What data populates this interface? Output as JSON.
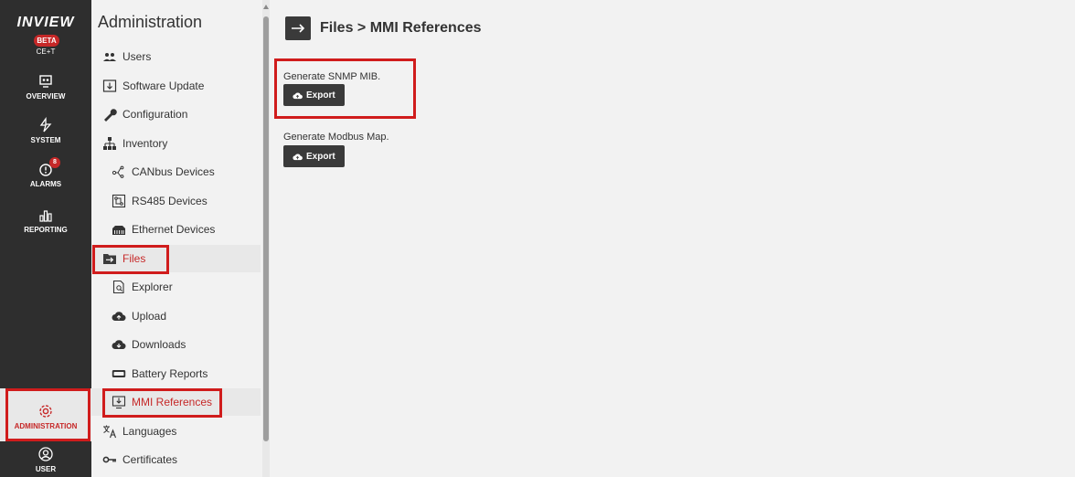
{
  "rail": {
    "logo": "INVIEW",
    "beta": "BETA",
    "model": "CE+T",
    "items": [
      {
        "label": "OVERVIEW",
        "icon": "monitor-icon"
      },
      {
        "label": "SYSTEM",
        "icon": "system-icon"
      },
      {
        "label": "ALARMS",
        "icon": "alarm-icon",
        "badge": "8"
      },
      {
        "label": "REPORTING",
        "icon": "bar-chart-icon"
      }
    ],
    "admin_label": "ADMINISTRATION",
    "user_label": "USER"
  },
  "sidebar": {
    "title": "Administration",
    "items": [
      {
        "label": "Users",
        "icon": "users-icon"
      },
      {
        "label": "Software Update",
        "icon": "software-update-icon"
      },
      {
        "label": "Configuration",
        "icon": "wrench-icon"
      },
      {
        "label": "Inventory",
        "icon": "inventory-tree-icon"
      },
      {
        "label": "CANbus Devices",
        "icon": "canbus-icon"
      },
      {
        "label": "RS485 Devices",
        "icon": "rs485-icon"
      },
      {
        "label": "Ethernet Devices",
        "icon": "ethernet-icon"
      },
      {
        "label": "Files",
        "icon": "folder-arrow-icon"
      },
      {
        "label": "Explorer",
        "icon": "file-search-icon"
      },
      {
        "label": "Upload",
        "icon": "cloud-upload-icon"
      },
      {
        "label": "Downloads",
        "icon": "cloud-download-icon"
      },
      {
        "label": "Battery Reports",
        "icon": "battery-icon"
      },
      {
        "label": "MMI References",
        "icon": "mmi-download-icon"
      },
      {
        "label": "Languages",
        "icon": "languages-icon"
      },
      {
        "label": "Certificates",
        "icon": "key-icon"
      }
    ]
  },
  "main": {
    "title": "Files > MMI References",
    "sections": [
      {
        "label": "Generate SNMP MIB.",
        "button": "Export"
      },
      {
        "label": "Generate Modbus Map.",
        "button": "Export"
      }
    ]
  },
  "colors": {
    "accent": "#c62828",
    "rail_bg": "#2e2e2e",
    "button_bg": "#3a3a3a",
    "highlight_box": "#d01c1c"
  }
}
